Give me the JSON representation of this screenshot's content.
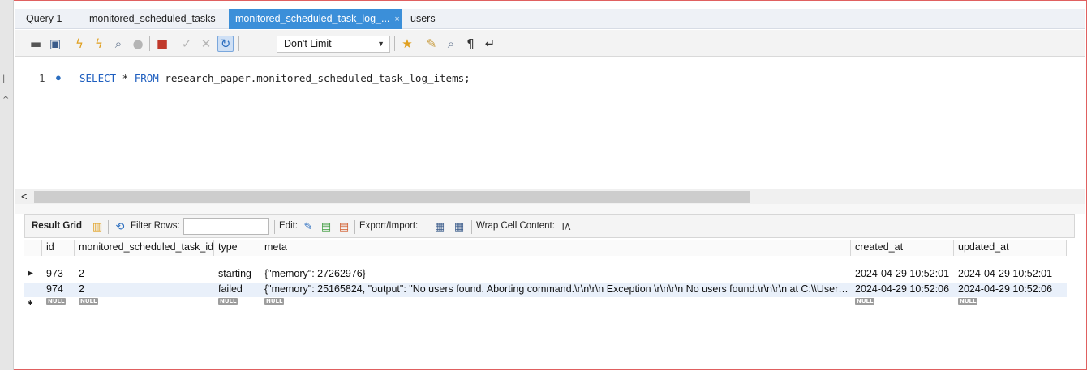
{
  "tabs": [
    {
      "label": "Query 1"
    },
    {
      "label": "monitored_scheduled_tasks"
    },
    {
      "label": "monitored_scheduled_task_log_...",
      "active": true,
      "close": "×"
    },
    {
      "label": "users"
    }
  ],
  "toolbar": {
    "icons": [
      "open-folder-icon",
      "save-icon",
      "execute-icon",
      "execute-current-icon",
      "explain-icon",
      "stop-icon",
      "toggle-error-icon",
      "commit-icon",
      "rollback-icon",
      "autocommit-icon",
      "bookmark-icon",
      "beautify-icon",
      "find-icon",
      "invisible-chars-icon",
      "wrap-icon"
    ],
    "limit_value": "Don't Limit"
  },
  "editor": {
    "line_number": "1",
    "line_marker": "●",
    "kw1": "SELECT",
    "mid1": " * ",
    "kw2": "FROM",
    "rest": " research_paper.monitored_scheduled_task_log_items;"
  },
  "result_toolbar": {
    "result_grid_label": "Result Grid",
    "filter_rows_label": "Filter Rows:",
    "edit_label": "Edit:",
    "export_import_label": "Export/Import:",
    "wrap_label": "Wrap Cell Content:",
    "filter_value": ""
  },
  "grid": {
    "columns": [
      "id",
      "monitored_scheduled_task_id",
      "type",
      "meta",
      "created_at",
      "updated_at"
    ],
    "rows": [
      [
        "973",
        "2",
        "starting",
        "{\"memory\": 27262976}",
        "2024-04-29 10:52:01",
        "2024-04-29 10:52:01"
      ],
      [
        "974",
        "2",
        "failed",
        "{\"memory\": 25165824, \"output\": \"No users found. Aborting command.\\r\\n\\r\\n  Exception \\r\\n\\r\\n  No users found.\\r\\n\\r\\n  at C:\\\\Users\\\\...",
        "2024-04-29 10:52:06",
        "2024-04-29 10:52:06"
      ]
    ],
    "null_label": "NULL",
    "current_row_marker": "▶",
    "new_row_marker": "✱"
  },
  "hscroll": {
    "arrow": "<"
  },
  "colors": {
    "active_tab": "#3b8fd9",
    "keyword": "#1f5fbf",
    "selection": "#cfe0f5"
  }
}
